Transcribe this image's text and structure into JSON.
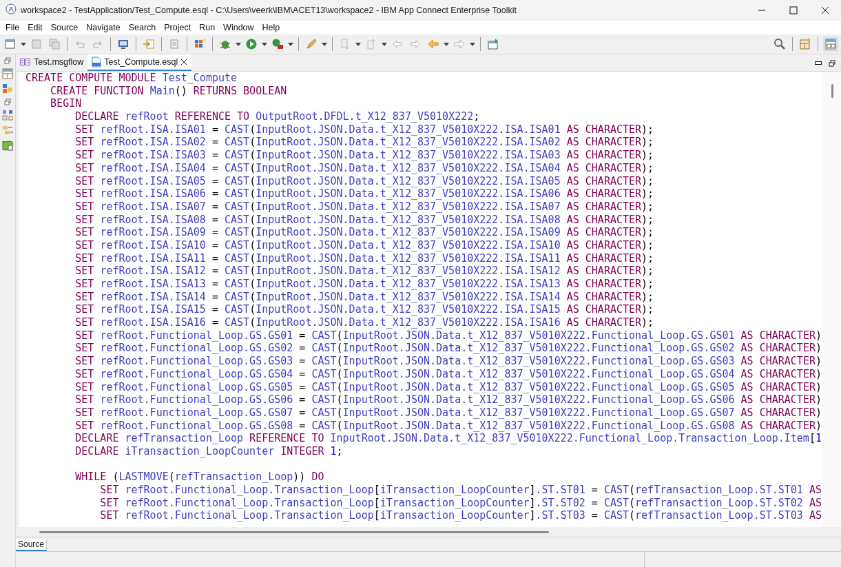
{
  "window": {
    "title": "workspace2 - TestApplication/Test_Compute.esql - C:\\Users\\veerk\\IBM\\ACET13\\workspace2 - IBM App Connect Enterprise Toolkit"
  },
  "menu": [
    "File",
    "Edit",
    "Source",
    "Navigate",
    "Search",
    "Project",
    "Run",
    "Window",
    "Help"
  ],
  "editor_tabs": [
    {
      "label": "Test.msgflow",
      "kind": "flow",
      "selected": false
    },
    {
      "label": "Test_Compute.esql",
      "kind": "esql",
      "selected": true
    }
  ],
  "code_lines": [
    {
      "kind": "code",
      "tokens": [
        {
          "kind": "keyword",
          "text": "CREATE COMPUTE MODULE "
        },
        {
          "kind": "identifier",
          "text": "Test_Compute"
        }
      ]
    },
    {
      "kind": "code",
      "tokens": [
        {
          "kind": "keyword",
          "text": "    CREATE FUNCTION "
        },
        {
          "kind": "identifier",
          "text": "Main"
        },
        {
          "kind": "punctuation",
          "text": "() "
        },
        {
          "kind": "keyword",
          "text": "RETURNS BOOLEAN"
        }
      ]
    },
    {
      "kind": "code",
      "tokens": [
        {
          "kind": "keyword",
          "text": "    BEGIN"
        }
      ]
    },
    {
      "kind": "code",
      "tokens": [
        {
          "kind": "keyword",
          "text": "        DECLARE "
        },
        {
          "kind": "identifier",
          "text": "refRoot"
        },
        {
          "kind": "keyword",
          "text": " REFERENCE TO "
        },
        {
          "kind": "identifier",
          "text": "OutputRoot.DFDL.t_X12_837_V5010X222"
        },
        {
          "kind": "punctuation",
          "text": ";"
        }
      ]
    },
    {
      "kind": "code",
      "tokens": [
        {
          "kind": "keyword",
          "text": "        SET "
        },
        {
          "kind": "identifier",
          "text": "refRoot.ISA.ISA01"
        },
        {
          "kind": "punctuation",
          "text": " = "
        },
        {
          "kind": "identifier",
          "text": "CAST"
        },
        {
          "kind": "punctuation",
          "text": "("
        },
        {
          "kind": "identifier",
          "text": "InputRoot.JSON.Data.t_X12_837_V5010X222.ISA.ISA01"
        },
        {
          "kind": "keyword",
          "text": " AS CHARACTER"
        },
        {
          "kind": "punctuation",
          "text": ");"
        }
      ]
    },
    {
      "kind": "code",
      "tokens": [
        {
          "kind": "keyword",
          "text": "        SET "
        },
        {
          "kind": "identifier",
          "text": "refRoot.ISA.ISA02"
        },
        {
          "kind": "punctuation",
          "text": " = "
        },
        {
          "kind": "identifier",
          "text": "CAST"
        },
        {
          "kind": "punctuation",
          "text": "("
        },
        {
          "kind": "identifier",
          "text": "InputRoot.JSON.Data.t_X12_837_V5010X222.ISA.ISA02"
        },
        {
          "kind": "keyword",
          "text": " AS CHARACTER"
        },
        {
          "kind": "punctuation",
          "text": ");"
        }
      ]
    },
    {
      "kind": "code",
      "tokens": [
        {
          "kind": "keyword",
          "text": "        SET "
        },
        {
          "kind": "identifier",
          "text": "refRoot.ISA.ISA03"
        },
        {
          "kind": "punctuation",
          "text": " = "
        },
        {
          "kind": "identifier",
          "text": "CAST"
        },
        {
          "kind": "punctuation",
          "text": "("
        },
        {
          "kind": "identifier",
          "text": "InputRoot.JSON.Data.t_X12_837_V5010X222.ISA.ISA03"
        },
        {
          "kind": "keyword",
          "text": " AS CHARACTER"
        },
        {
          "kind": "punctuation",
          "text": ");"
        }
      ]
    },
    {
      "kind": "code",
      "tokens": [
        {
          "kind": "keyword",
          "text": "        SET "
        },
        {
          "kind": "identifier",
          "text": "refRoot.ISA.ISA04"
        },
        {
          "kind": "punctuation",
          "text": " = "
        },
        {
          "kind": "identifier",
          "text": "CAST"
        },
        {
          "kind": "punctuation",
          "text": "("
        },
        {
          "kind": "identifier",
          "text": "InputRoot.JSON.Data.t_X12_837_V5010X222.ISA.ISA04"
        },
        {
          "kind": "keyword",
          "text": " AS CHARACTER"
        },
        {
          "kind": "punctuation",
          "text": ");"
        }
      ]
    },
    {
      "kind": "code",
      "tokens": [
        {
          "kind": "keyword",
          "text": "        SET "
        },
        {
          "kind": "identifier",
          "text": "refRoot.ISA.ISA05"
        },
        {
          "kind": "punctuation",
          "text": " = "
        },
        {
          "kind": "identifier",
          "text": "CAST"
        },
        {
          "kind": "punctuation",
          "text": "("
        },
        {
          "kind": "identifier",
          "text": "InputRoot.JSON.Data.t_X12_837_V5010X222.ISA.ISA05"
        },
        {
          "kind": "keyword",
          "text": " AS CHARACTER"
        },
        {
          "kind": "punctuation",
          "text": ");"
        }
      ]
    },
    {
      "kind": "code",
      "tokens": [
        {
          "kind": "keyword",
          "text": "        SET "
        },
        {
          "kind": "identifier",
          "text": "refRoot.ISA.ISA06"
        },
        {
          "kind": "punctuation",
          "text": " = "
        },
        {
          "kind": "identifier",
          "text": "CAST"
        },
        {
          "kind": "punctuation",
          "text": "("
        },
        {
          "kind": "identifier",
          "text": "InputRoot.JSON.Data.t_X12_837_V5010X222.ISA.ISA06"
        },
        {
          "kind": "keyword",
          "text": " AS CHARACTER"
        },
        {
          "kind": "punctuation",
          "text": ");"
        }
      ]
    },
    {
      "kind": "code",
      "tokens": [
        {
          "kind": "keyword",
          "text": "        SET "
        },
        {
          "kind": "identifier",
          "text": "refRoot.ISA.ISA07"
        },
        {
          "kind": "punctuation",
          "text": " = "
        },
        {
          "kind": "identifier",
          "text": "CAST"
        },
        {
          "kind": "punctuation",
          "text": "("
        },
        {
          "kind": "identifier",
          "text": "InputRoot.JSON.Data.t_X12_837_V5010X222.ISA.ISA07"
        },
        {
          "kind": "keyword",
          "text": " AS CHARACTER"
        },
        {
          "kind": "punctuation",
          "text": ");"
        }
      ]
    },
    {
      "kind": "code",
      "tokens": [
        {
          "kind": "keyword",
          "text": "        SET "
        },
        {
          "kind": "identifier",
          "text": "refRoot.ISA.ISA08"
        },
        {
          "kind": "punctuation",
          "text": " = "
        },
        {
          "kind": "identifier",
          "text": "CAST"
        },
        {
          "kind": "punctuation",
          "text": "("
        },
        {
          "kind": "identifier",
          "text": "InputRoot.JSON.Data.t_X12_837_V5010X222.ISA.ISA08"
        },
        {
          "kind": "keyword",
          "text": " AS CHARACTER"
        },
        {
          "kind": "punctuation",
          "text": ");"
        }
      ]
    },
    {
      "kind": "code",
      "tokens": [
        {
          "kind": "keyword",
          "text": "        SET "
        },
        {
          "kind": "identifier",
          "text": "refRoot.ISA.ISA09"
        },
        {
          "kind": "punctuation",
          "text": " = "
        },
        {
          "kind": "identifier",
          "text": "CAST"
        },
        {
          "kind": "punctuation",
          "text": "("
        },
        {
          "kind": "identifier",
          "text": "InputRoot.JSON.Data.t_X12_837_V5010X222.ISA.ISA09"
        },
        {
          "kind": "keyword",
          "text": " AS CHARACTER"
        },
        {
          "kind": "punctuation",
          "text": ");"
        }
      ]
    },
    {
      "kind": "code",
      "tokens": [
        {
          "kind": "keyword",
          "text": "        SET "
        },
        {
          "kind": "identifier",
          "text": "refRoot.ISA.ISA10"
        },
        {
          "kind": "punctuation",
          "text": " = "
        },
        {
          "kind": "identifier",
          "text": "CAST"
        },
        {
          "kind": "punctuation",
          "text": "("
        },
        {
          "kind": "identifier",
          "text": "InputRoot.JSON.Data.t_X12_837_V5010X222.ISA.ISA10"
        },
        {
          "kind": "keyword",
          "text": " AS CHARACTER"
        },
        {
          "kind": "punctuation",
          "text": ");"
        }
      ]
    },
    {
      "kind": "code",
      "tokens": [
        {
          "kind": "keyword",
          "text": "        SET "
        },
        {
          "kind": "identifier",
          "text": "refRoot.ISA.ISA11"
        },
        {
          "kind": "punctuation",
          "text": " = "
        },
        {
          "kind": "identifier",
          "text": "CAST"
        },
        {
          "kind": "punctuation",
          "text": "("
        },
        {
          "kind": "identifier",
          "text": "InputRoot.JSON.Data.t_X12_837_V5010X222.ISA.ISA11"
        },
        {
          "kind": "keyword",
          "text": " AS CHARACTER"
        },
        {
          "kind": "punctuation",
          "text": ");"
        }
      ]
    },
    {
      "kind": "code",
      "tokens": [
        {
          "kind": "keyword",
          "text": "        SET "
        },
        {
          "kind": "identifier",
          "text": "refRoot.ISA.ISA12"
        },
        {
          "kind": "punctuation",
          "text": " = "
        },
        {
          "kind": "identifier",
          "text": "CAST"
        },
        {
          "kind": "punctuation",
          "text": "("
        },
        {
          "kind": "identifier",
          "text": "InputRoot.JSON.Data.t_X12_837_V5010X222.ISA.ISA12"
        },
        {
          "kind": "keyword",
          "text": " AS CHARACTER"
        },
        {
          "kind": "punctuation",
          "text": ");"
        }
      ]
    },
    {
      "kind": "code",
      "tokens": [
        {
          "kind": "keyword",
          "text": "        SET "
        },
        {
          "kind": "identifier",
          "text": "refRoot.ISA.ISA13"
        },
        {
          "kind": "punctuation",
          "text": " = "
        },
        {
          "kind": "identifier",
          "text": "CAST"
        },
        {
          "kind": "punctuation",
          "text": "("
        },
        {
          "kind": "identifier",
          "text": "InputRoot.JSON.Data.t_X12_837_V5010X222.ISA.ISA13"
        },
        {
          "kind": "keyword",
          "text": " AS CHARACTER"
        },
        {
          "kind": "punctuation",
          "text": ");"
        }
      ]
    },
    {
      "kind": "code",
      "tokens": [
        {
          "kind": "keyword",
          "text": "        SET "
        },
        {
          "kind": "identifier",
          "text": "refRoot.ISA.ISA14"
        },
        {
          "kind": "punctuation",
          "text": " = "
        },
        {
          "kind": "identifier",
          "text": "CAST"
        },
        {
          "kind": "punctuation",
          "text": "("
        },
        {
          "kind": "identifier",
          "text": "InputRoot.JSON.Data.t_X12_837_V5010X222.ISA.ISA14"
        },
        {
          "kind": "keyword",
          "text": " AS CHARACTER"
        },
        {
          "kind": "punctuation",
          "text": ");"
        }
      ]
    },
    {
      "kind": "code",
      "tokens": [
        {
          "kind": "keyword",
          "text": "        SET "
        },
        {
          "kind": "identifier",
          "text": "refRoot.ISA.ISA15"
        },
        {
          "kind": "punctuation",
          "text": " = "
        },
        {
          "kind": "identifier",
          "text": "CAST"
        },
        {
          "kind": "punctuation",
          "text": "("
        },
        {
          "kind": "identifier",
          "text": "InputRoot.JSON.Data.t_X12_837_V5010X222.ISA.ISA15"
        },
        {
          "kind": "keyword",
          "text": " AS CHARACTER"
        },
        {
          "kind": "punctuation",
          "text": ");"
        }
      ]
    },
    {
      "kind": "code",
      "tokens": [
        {
          "kind": "keyword",
          "text": "        SET "
        },
        {
          "kind": "identifier",
          "text": "refRoot.ISA.ISA16"
        },
        {
          "kind": "punctuation",
          "text": " = "
        },
        {
          "kind": "identifier",
          "text": "CAST"
        },
        {
          "kind": "punctuation",
          "text": "("
        },
        {
          "kind": "identifier",
          "text": "InputRoot.JSON.Data.t_X12_837_V5010X222.ISA.ISA16"
        },
        {
          "kind": "keyword",
          "text": " AS CHARACTER"
        },
        {
          "kind": "punctuation",
          "text": ");"
        }
      ]
    },
    {
      "kind": "code",
      "tokens": [
        {
          "kind": "keyword",
          "text": "        SET "
        },
        {
          "kind": "identifier",
          "text": "refRoot.Functional_Loop.GS.GS01"
        },
        {
          "kind": "punctuation",
          "text": " = "
        },
        {
          "kind": "identifier",
          "text": "CAST"
        },
        {
          "kind": "punctuation",
          "text": "("
        },
        {
          "kind": "identifier",
          "text": "InputRoot.JSON.Data.t_X12_837_V5010X222.Functional_Loop.GS.GS01"
        },
        {
          "kind": "keyword",
          "text": " AS CHARACTER"
        },
        {
          "kind": "punctuation",
          "text": ")"
        }
      ]
    },
    {
      "kind": "code",
      "tokens": [
        {
          "kind": "keyword",
          "text": "        SET "
        },
        {
          "kind": "identifier",
          "text": "refRoot.Functional_Loop.GS.GS02"
        },
        {
          "kind": "punctuation",
          "text": " = "
        },
        {
          "kind": "identifier",
          "text": "CAST"
        },
        {
          "kind": "punctuation",
          "text": "("
        },
        {
          "kind": "identifier",
          "text": "InputRoot.JSON.Data.t_X12_837_V5010X222.Functional_Loop.GS.GS02"
        },
        {
          "kind": "keyword",
          "text": " AS CHARACTER"
        },
        {
          "kind": "punctuation",
          "text": ")"
        }
      ]
    },
    {
      "kind": "code",
      "tokens": [
        {
          "kind": "keyword",
          "text": "        SET "
        },
        {
          "kind": "identifier",
          "text": "refRoot.Functional_Loop.GS.GS03"
        },
        {
          "kind": "punctuation",
          "text": " = "
        },
        {
          "kind": "identifier",
          "text": "CAST"
        },
        {
          "kind": "punctuation",
          "text": "("
        },
        {
          "kind": "identifier",
          "text": "InputRoot.JSON.Data.t_X12_837_V5010X222.Functional_Loop.GS.GS03"
        },
        {
          "kind": "keyword",
          "text": " AS CHARACTER"
        },
        {
          "kind": "punctuation",
          "text": ")"
        }
      ]
    },
    {
      "kind": "code",
      "tokens": [
        {
          "kind": "keyword",
          "text": "        SET "
        },
        {
          "kind": "identifier",
          "text": "refRoot.Functional_Loop.GS.GS04"
        },
        {
          "kind": "punctuation",
          "text": " = "
        },
        {
          "kind": "identifier",
          "text": "CAST"
        },
        {
          "kind": "punctuation",
          "text": "("
        },
        {
          "kind": "identifier",
          "text": "InputRoot.JSON.Data.t_X12_837_V5010X222.Functional_Loop.GS.GS04"
        },
        {
          "kind": "keyword",
          "text": " AS CHARACTER"
        },
        {
          "kind": "punctuation",
          "text": ")"
        }
      ]
    },
    {
      "kind": "code",
      "tokens": [
        {
          "kind": "keyword",
          "text": "        SET "
        },
        {
          "kind": "identifier",
          "text": "refRoot.Functional_Loop.GS.GS05"
        },
        {
          "kind": "punctuation",
          "text": " = "
        },
        {
          "kind": "identifier",
          "text": "CAST"
        },
        {
          "kind": "punctuation",
          "text": "("
        },
        {
          "kind": "identifier",
          "text": "InputRoot.JSON.Data.t_X12_837_V5010X222.Functional_Loop.GS.GS05"
        },
        {
          "kind": "keyword",
          "text": " AS CHARACTER"
        },
        {
          "kind": "punctuation",
          "text": ")"
        }
      ]
    },
    {
      "kind": "code",
      "tokens": [
        {
          "kind": "keyword",
          "text": "        SET "
        },
        {
          "kind": "identifier",
          "text": "refRoot.Functional_Loop.GS.GS06"
        },
        {
          "kind": "punctuation",
          "text": " = "
        },
        {
          "kind": "identifier",
          "text": "CAST"
        },
        {
          "kind": "punctuation",
          "text": "("
        },
        {
          "kind": "identifier",
          "text": "InputRoot.JSON.Data.t_X12_837_V5010X222.Functional_Loop.GS.GS06"
        },
        {
          "kind": "keyword",
          "text": " AS CHARACTER"
        },
        {
          "kind": "punctuation",
          "text": ")"
        }
      ]
    },
    {
      "kind": "code",
      "tokens": [
        {
          "kind": "keyword",
          "text": "        SET "
        },
        {
          "kind": "identifier",
          "text": "refRoot.Functional_Loop.GS.GS07"
        },
        {
          "kind": "punctuation",
          "text": " = "
        },
        {
          "kind": "identifier",
          "text": "CAST"
        },
        {
          "kind": "punctuation",
          "text": "("
        },
        {
          "kind": "identifier",
          "text": "InputRoot.JSON.Data.t_X12_837_V5010X222.Functional_Loop.GS.GS07"
        },
        {
          "kind": "keyword",
          "text": " AS CHARACTER"
        },
        {
          "kind": "punctuation",
          "text": ")"
        }
      ]
    },
    {
      "kind": "code",
      "tokens": [
        {
          "kind": "keyword",
          "text": "        SET "
        },
        {
          "kind": "identifier",
          "text": "refRoot.Functional_Loop.GS.GS08"
        },
        {
          "kind": "punctuation",
          "text": " = "
        },
        {
          "kind": "identifier",
          "text": "CAST"
        },
        {
          "kind": "punctuation",
          "text": "("
        },
        {
          "kind": "identifier",
          "text": "InputRoot.JSON.Data.t_X12_837_V5010X222.Functional_Loop.GS.GS08"
        },
        {
          "kind": "keyword",
          "text": " AS CHARACTER"
        },
        {
          "kind": "punctuation",
          "text": ")"
        }
      ]
    },
    {
      "kind": "code",
      "tokens": [
        {
          "kind": "keyword",
          "text": "        DECLARE "
        },
        {
          "kind": "identifier",
          "text": "refTransaction_Loop"
        },
        {
          "kind": "keyword",
          "text": " REFERENCE TO "
        },
        {
          "kind": "identifier",
          "text": "InputRoot.JSON.Data.t_X12_837_V5010X222.Functional_Loop.Transaction_Loop.Item"
        },
        {
          "kind": "punctuation",
          "text": "["
        },
        {
          "kind": "number",
          "text": "1"
        }
      ]
    },
    {
      "kind": "code",
      "tokens": [
        {
          "kind": "keyword",
          "text": "        DECLARE "
        },
        {
          "kind": "identifier",
          "text": "iTransaction_LoopCounter"
        },
        {
          "kind": "keyword",
          "text": " INTEGER "
        },
        {
          "kind": "number",
          "text": "1"
        },
        {
          "kind": "punctuation",
          "text": ";"
        }
      ]
    },
    {
      "kind": "blank"
    },
    {
      "kind": "code",
      "tokens": [
        {
          "kind": "keyword",
          "text": "        WHILE "
        },
        {
          "kind": "punctuation",
          "text": "("
        },
        {
          "kind": "identifier",
          "text": "LASTMOVE"
        },
        {
          "kind": "punctuation",
          "text": "("
        },
        {
          "kind": "identifier",
          "text": "refTransaction_Loop"
        },
        {
          "kind": "punctuation",
          "text": ")) "
        },
        {
          "kind": "keyword",
          "text": "DO"
        }
      ]
    },
    {
      "kind": "code",
      "tokens": [
        {
          "kind": "keyword",
          "text": "            SET "
        },
        {
          "kind": "identifier",
          "text": "refRoot.Functional_Loop.Transaction_Loop"
        },
        {
          "kind": "punctuation",
          "text": "["
        },
        {
          "kind": "identifier",
          "text": "iTransaction_LoopCounter"
        },
        {
          "kind": "punctuation",
          "text": "]"
        },
        {
          "kind": "identifier",
          "text": ".ST.ST01"
        },
        {
          "kind": "punctuation",
          "text": " = "
        },
        {
          "kind": "identifier",
          "text": "CAST"
        },
        {
          "kind": "punctuation",
          "text": "("
        },
        {
          "kind": "identifier",
          "text": "refTransaction_Loop.ST.ST01"
        },
        {
          "kind": "keyword",
          "text": " AS"
        }
      ]
    },
    {
      "kind": "code",
      "tokens": [
        {
          "kind": "keyword",
          "text": "            SET "
        },
        {
          "kind": "identifier",
          "text": "refRoot.Functional_Loop.Transaction_Loop"
        },
        {
          "kind": "punctuation",
          "text": "["
        },
        {
          "kind": "identifier",
          "text": "iTransaction_LoopCounter"
        },
        {
          "kind": "punctuation",
          "text": "]"
        },
        {
          "kind": "identifier",
          "text": ".ST.ST02"
        },
        {
          "kind": "punctuation",
          "text": " = "
        },
        {
          "kind": "identifier",
          "text": "CAST"
        },
        {
          "kind": "punctuation",
          "text": "("
        },
        {
          "kind": "identifier",
          "text": "refTransaction_Loop.ST.ST02"
        },
        {
          "kind": "keyword",
          "text": " AS"
        }
      ]
    },
    {
      "kind": "code",
      "tokens": [
        {
          "kind": "keyword",
          "text": "            SET "
        },
        {
          "kind": "identifier",
          "text": "refRoot.Functional_Loop.Transaction_Loop"
        },
        {
          "kind": "punctuation",
          "text": "["
        },
        {
          "kind": "identifier",
          "text": "iTransaction_LoopCounter"
        },
        {
          "kind": "punctuation",
          "text": "]"
        },
        {
          "kind": "identifier",
          "text": ".ST.ST03"
        },
        {
          "kind": "punctuation",
          "text": " = "
        },
        {
          "kind": "identifier",
          "text": "CAST"
        },
        {
          "kind": "punctuation",
          "text": "("
        },
        {
          "kind": "identifier",
          "text": "refTransaction_Loop.ST.ST03"
        },
        {
          "kind": "keyword",
          "text": " AS"
        }
      ]
    }
  ],
  "bottom_tabs": [
    {
      "label": "Source",
      "selected": true
    }
  ]
}
